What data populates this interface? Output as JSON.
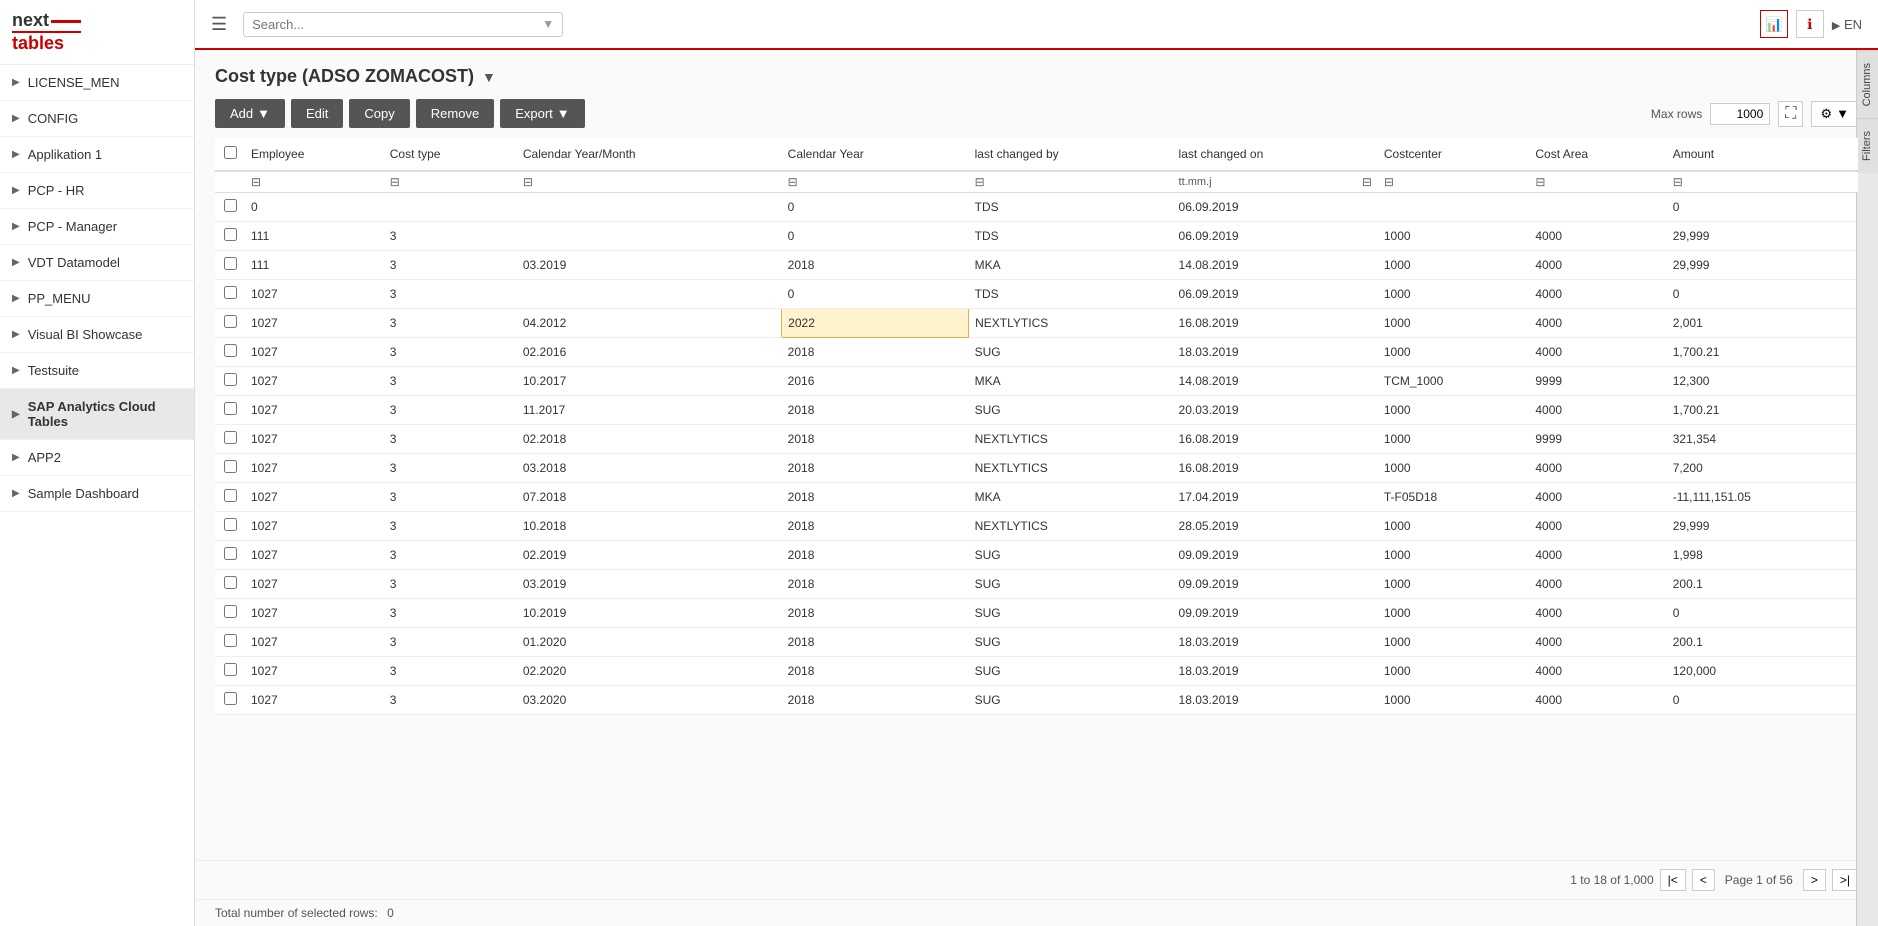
{
  "logo": {
    "text_next": "next",
    "text_tables": "tables",
    "icon": "≡≡"
  },
  "topbar": {
    "hamburger": "☰",
    "search_placeholder": "Search...",
    "lang": "EN",
    "icons": [
      "📊",
      "ℹ"
    ]
  },
  "sidebar": {
    "items": [
      {
        "id": "license-men",
        "label": "LICENSE_MEN"
      },
      {
        "id": "config",
        "label": "CONFIG"
      },
      {
        "id": "applikation-1",
        "label": "Applikation 1"
      },
      {
        "id": "pcp-hr",
        "label": "PCP - HR"
      },
      {
        "id": "pcp-manager",
        "label": "PCP - Manager"
      },
      {
        "id": "vdt-datamodel",
        "label": "VDT Datamodel"
      },
      {
        "id": "pp-menu",
        "label": "PP_MENU"
      },
      {
        "id": "visual-bi-showcase",
        "label": "Visual BI Showcase"
      },
      {
        "id": "testsuite",
        "label": "Testsuite"
      },
      {
        "id": "sap-analytics-cloud-tables",
        "label": "SAP Analytics Cloud Tables",
        "active": true
      },
      {
        "id": "app2",
        "label": "APP2"
      },
      {
        "id": "sample-dashboard",
        "label": "Sample Dashboard"
      }
    ]
  },
  "page": {
    "title": "Cost type (ADSO ZOMACOST)",
    "title_arrow": "▼"
  },
  "toolbar": {
    "add_label": "Add",
    "add_arrow": "▼",
    "edit_label": "Edit",
    "copy_label": "Copy",
    "remove_label": "Remove",
    "export_label": "Export",
    "export_arrow": "▼",
    "max_rows_label": "Max rows",
    "max_rows_value": "1000",
    "fullscreen_icon": "⛶",
    "settings_icon": "⚙",
    "settings_arrow": "▼"
  },
  "table": {
    "columns": [
      {
        "id": "select",
        "label": ""
      },
      {
        "id": "employee",
        "label": "Employee"
      },
      {
        "id": "cost-type",
        "label": "Cost type"
      },
      {
        "id": "cal-year-month",
        "label": "Calendar Year/Month"
      },
      {
        "id": "cal-year",
        "label": "Calendar Year"
      },
      {
        "id": "last-changed-by",
        "label": "last changed by"
      },
      {
        "id": "last-changed-on",
        "label": "last changed on"
      },
      {
        "id": "costcenter",
        "label": "Costcenter"
      },
      {
        "id": "cost-area",
        "label": "Cost Area"
      },
      {
        "id": "amount",
        "label": "Amount"
      }
    ],
    "date_format_hint": "tt.mm.j",
    "rows": [
      {
        "select": false,
        "employee": "0",
        "cost_type": "",
        "cal_year_month": "",
        "cal_year": "0",
        "last_changed_by": "TDS",
        "last_changed_on": "06.09.2019",
        "costcenter": "",
        "cost_area": "",
        "amount": "0"
      },
      {
        "select": false,
        "employee": "111",
        "cost_type": "3",
        "cal_year_month": "",
        "cal_year": "0",
        "last_changed_by": "TDS",
        "last_changed_on": "06.09.2019",
        "costcenter": "1000",
        "cost_area": "4000",
        "amount": "29,999"
      },
      {
        "select": false,
        "employee": "111",
        "cost_type": "3",
        "cal_year_month": "03.2019",
        "cal_year": "2018",
        "last_changed_by": "MKA",
        "last_changed_on": "14.08.2019",
        "costcenter": "1000",
        "cost_area": "4000",
        "amount": "29,999"
      },
      {
        "select": false,
        "employee": "1027",
        "cost_type": "3",
        "cal_year_month": "",
        "cal_year": "0",
        "last_changed_by": "TDS",
        "last_changed_on": "06.09.2019",
        "costcenter": "1000",
        "cost_area": "4000",
        "amount": "0"
      },
      {
        "select": false,
        "employee": "1027",
        "cost_type": "3",
        "cal_year_month": "04.2012",
        "cal_year": "2022",
        "last_changed_by": "NEXTLYTICS",
        "last_changed_on": "16.08.2019",
        "costcenter": "1000",
        "cost_area": "4000",
        "amount": "2,001",
        "highlight_cal_year": true
      },
      {
        "select": false,
        "employee": "1027",
        "cost_type": "3",
        "cal_year_month": "02.2016",
        "cal_year": "2018",
        "last_changed_by": "SUG",
        "last_changed_on": "18.03.2019",
        "costcenter": "1000",
        "cost_area": "4000",
        "amount": "1,700.21"
      },
      {
        "select": false,
        "employee": "1027",
        "cost_type": "3",
        "cal_year_month": "10.2017",
        "cal_year": "2016",
        "last_changed_by": "MKA",
        "last_changed_on": "14.08.2019",
        "costcenter": "TCM_1000",
        "cost_area": "9999",
        "amount": "12,300"
      },
      {
        "select": false,
        "employee": "1027",
        "cost_type": "3",
        "cal_year_month": "11.2017",
        "cal_year": "2018",
        "last_changed_by": "SUG",
        "last_changed_on": "20.03.2019",
        "costcenter": "1000",
        "cost_area": "4000",
        "amount": "1,700.21"
      },
      {
        "select": false,
        "employee": "1027",
        "cost_type": "3",
        "cal_year_month": "02.2018",
        "cal_year": "2018",
        "last_changed_by": "NEXTLYTICS",
        "last_changed_on": "16.08.2019",
        "costcenter": "1000",
        "cost_area": "9999",
        "amount": "321,354"
      },
      {
        "select": false,
        "employee": "1027",
        "cost_type": "3",
        "cal_year_month": "03.2018",
        "cal_year": "2018",
        "last_changed_by": "NEXTLYTICS",
        "last_changed_on": "16.08.2019",
        "costcenter": "1000",
        "cost_area": "4000",
        "amount": "7,200"
      },
      {
        "select": false,
        "employee": "1027",
        "cost_type": "3",
        "cal_year_month": "07.2018",
        "cal_year": "2018",
        "last_changed_by": "MKA",
        "last_changed_on": "17.04.2019",
        "costcenter": "T-F05D18",
        "cost_area": "4000",
        "amount": "-11,111,151.05"
      },
      {
        "select": false,
        "employee": "1027",
        "cost_type": "3",
        "cal_year_month": "10.2018",
        "cal_year": "2018",
        "last_changed_by": "NEXTLYTICS",
        "last_changed_on": "28.05.2019",
        "costcenter": "1000",
        "cost_area": "4000",
        "amount": "29,999"
      },
      {
        "select": false,
        "employee": "1027",
        "cost_type": "3",
        "cal_year_month": "02.2019",
        "cal_year": "2018",
        "last_changed_by": "SUG",
        "last_changed_on": "09.09.2019",
        "costcenter": "1000",
        "cost_area": "4000",
        "amount": "1,998"
      },
      {
        "select": false,
        "employee": "1027",
        "cost_type": "3",
        "cal_year_month": "03.2019",
        "cal_year": "2018",
        "last_changed_by": "SUG",
        "last_changed_on": "09.09.2019",
        "costcenter": "1000",
        "cost_area": "4000",
        "amount": "200.1"
      },
      {
        "select": false,
        "employee": "1027",
        "cost_type": "3",
        "cal_year_month": "10.2019",
        "cal_year": "2018",
        "last_changed_by": "SUG",
        "last_changed_on": "09.09.2019",
        "costcenter": "1000",
        "cost_area": "4000",
        "amount": "0"
      },
      {
        "select": false,
        "employee": "1027",
        "cost_type": "3",
        "cal_year_month": "01.2020",
        "cal_year": "2018",
        "last_changed_by": "SUG",
        "last_changed_on": "18.03.2019",
        "costcenter": "1000",
        "cost_area": "4000",
        "amount": "200.1"
      },
      {
        "select": false,
        "employee": "1027",
        "cost_type": "3",
        "cal_year_month": "02.2020",
        "cal_year": "2018",
        "last_changed_by": "SUG",
        "last_changed_on": "18.03.2019",
        "costcenter": "1000",
        "cost_area": "4000",
        "amount": "120,000"
      },
      {
        "select": false,
        "employee": "1027",
        "cost_type": "3",
        "cal_year_month": "03.2020",
        "cal_year": "2018",
        "last_changed_by": "SUG",
        "last_changed_on": "18.03.2019",
        "costcenter": "1000",
        "cost_area": "4000",
        "amount": "0"
      }
    ]
  },
  "pagination": {
    "info": "1 to 18 of 1,000",
    "page_info": "Page 1 of 56",
    "first": "|<",
    "prev": "<",
    "next": ">",
    "last": ">|"
  },
  "footer": {
    "selected_label": "Total number of selected rows:",
    "selected_count": "0"
  },
  "right_panel": {
    "tabs": [
      "Columns",
      "Filters"
    ]
  }
}
